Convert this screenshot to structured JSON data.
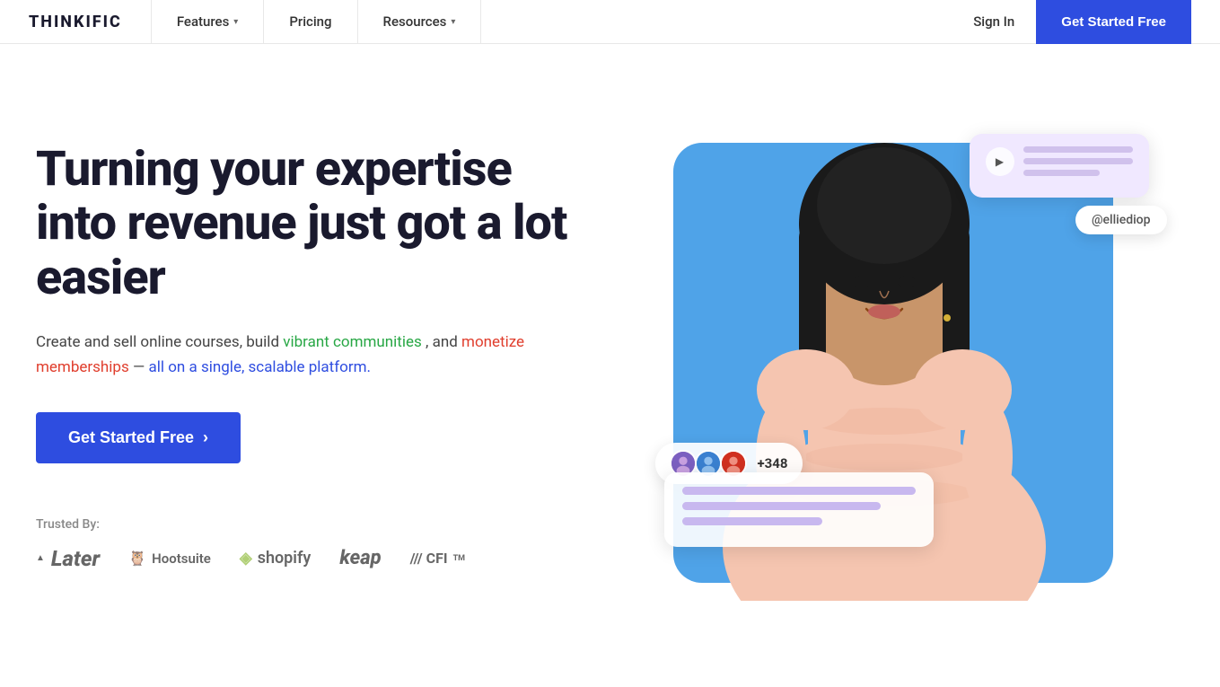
{
  "brand": {
    "logo": "THINKIFIC"
  },
  "nav": {
    "links": [
      {
        "label": "Features",
        "hasDropdown": true
      },
      {
        "label": "Pricing",
        "hasDropdown": false
      },
      {
        "label": "Resources",
        "hasDropdown": true
      }
    ],
    "sign_in": "Sign In",
    "cta": "Get Started Free"
  },
  "hero": {
    "title": "Turning your expertise into revenue just got a lot easier",
    "subtitle_part1": "Create and sell online courses, build vibrant communities, and monetize memberships",
    "subtitle_highlight": " — all on a single, scalable platform.",
    "cta_label": "Get Started Free",
    "trusted_label": "Trusted By:",
    "logos": [
      {
        "name": "Later",
        "icon": "▲"
      },
      {
        "name": "Hootsuite",
        "icon": "🦉"
      },
      {
        "name": "Shopify",
        "icon": "◈"
      },
      {
        "name": "keap",
        "icon": ""
      },
      {
        "name": "/// CFI™",
        "icon": ""
      }
    ],
    "social": {
      "username": "@elliediop",
      "count": "+348"
    }
  }
}
